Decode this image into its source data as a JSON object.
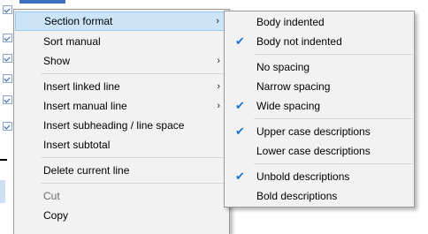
{
  "context_menu": {
    "items": [
      {
        "label": "Section format",
        "arrow": "›",
        "state": "highlighted"
      },
      {
        "label": "Sort manual"
      },
      {
        "label": "Show",
        "arrow": "›"
      },
      {
        "label": "Insert linked line",
        "arrow": "›"
      },
      {
        "label": "Insert manual line",
        "arrow": "›"
      },
      {
        "label": "Insert subheading / line space"
      },
      {
        "label": "Insert subtotal"
      },
      {
        "label": "Delete current line"
      },
      {
        "label": "Cut",
        "state": "disabled"
      },
      {
        "label": "Copy"
      }
    ]
  },
  "section_format_submenu": {
    "items": [
      {
        "label": "Body indented",
        "checked": false
      },
      {
        "label": "Body not indented",
        "checked": true
      },
      {
        "label": "No spacing",
        "checked": false
      },
      {
        "label": "Narrow spacing",
        "checked": false
      },
      {
        "label": "Wide spacing",
        "checked": true
      },
      {
        "label": "Upper case descriptions",
        "checked": true
      },
      {
        "label": "Lower case descriptions",
        "checked": false
      },
      {
        "label": "Unbold descriptions",
        "checked": true
      },
      {
        "label": "Bold descriptions",
        "checked": false
      }
    ],
    "check_glyph": "✔"
  },
  "colors": {
    "menu_background": "#f2f2f2",
    "highlight": "#cce4f7",
    "highlight_border": "#99c9ef",
    "check": "#1a73d1",
    "disabled_text": "#6d6d6d"
  }
}
